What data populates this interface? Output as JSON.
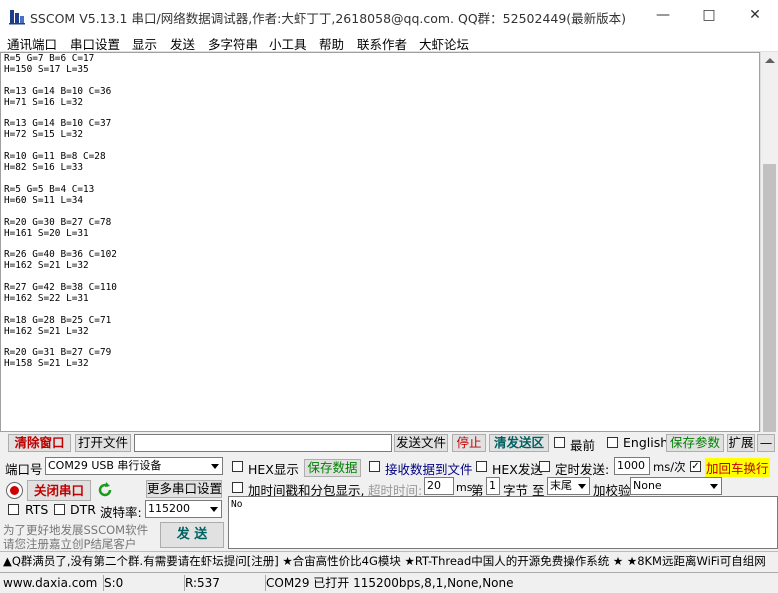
{
  "window": {
    "title": "SSCOM V5.13.1 串口/网络数据调试器,作者:大虾丁丁,2618058@qq.com. QQ群：52502449(最新版本)"
  },
  "menu": [
    "通讯端口",
    "串口设置",
    "显示",
    "发送",
    "多字符串",
    "小工具",
    "帮助",
    "联系作者",
    "大虾论坛"
  ],
  "receive": {
    "text": "R=5 G=7 B=6 C=17\nH=150 S=17 L=35\n\nR=13 G=14 B=10 C=36\nH=71 S=16 L=32\n\nR=13 G=14 B=10 C=37\nH=72 S=15 L=32\n\nR=10 G=11 B=8 C=28\nH=82 S=16 L=33\n\nR=5 G=5 B=4 C=13\nH=60 S=11 L=34\n\nR=20 G=30 B=27 C=78\nH=161 S=20 L=31\n\nR=26 G=40 B=36 C=102\nH=162 S=21 L=32\n\nR=27 G=42 B=38 C=110\nH=162 S=22 L=31\n\nR=18 G=28 B=25 C=71\nH=162 S=21 L=32\n\nR=20 G=31 B=27 C=79\nH=158 S=21 L=32"
  },
  "toolbar": {
    "clear_window": "清除窗口",
    "open_file": "打开文件",
    "file_path": "",
    "send_file": "发送文件",
    "stop": "停止",
    "clear_send": "清发送区",
    "topmost": "最前",
    "english": "English",
    "save_params": "保存参数",
    "expand": "扩展",
    "minus": "—"
  },
  "port": {
    "port_label": "端口号",
    "port_value": "COM29 USB 串行设备",
    "close_port": "关闭串口",
    "more_settings": "更多串口设置",
    "rts": "RTS",
    "dtr": "DTR",
    "baud_label": "波特率:",
    "baud_value": "115200"
  },
  "options": {
    "hex_display": "HEX显示",
    "save_data": "保存数据",
    "recv_to_file": "接收数据到文件",
    "hex_send": "HEX发送",
    "timed_send": "定时发送:",
    "interval": "1000",
    "interval_unit": "ms/次",
    "add_crlf": "加回车换行",
    "timestamp": "加时间戳和分包显示,",
    "timeout_label": "超时时间:",
    "timeout_value": "20",
    "timeout_unit": "ms",
    "byte_prefix": "第",
    "byte_index": "1",
    "byte_suffix": "字节 至",
    "end_value": "末尾",
    "checksum_label": "加校验",
    "checksum_value": "None"
  },
  "send": {
    "input": "No",
    "send_button": "发 送",
    "promo_line1": "为了更好地发展SSCOM软件",
    "promo_line2": "请您注册嘉立创P结尾客户"
  },
  "ticker": "▲Q群满员了,没有第二个群.有需要请在虾坛提问[注册] ★合宙高性价比4G模块 ★RT-Thread中国人的开源免费操作系统 ★ ★8KM远距离WiFi可自组网",
  "status": {
    "url": "www.daxia.com",
    "sent": "S:0",
    "received": "R:537",
    "port_state": "COM29 已打开  115200bps,8,1,None,None"
  }
}
